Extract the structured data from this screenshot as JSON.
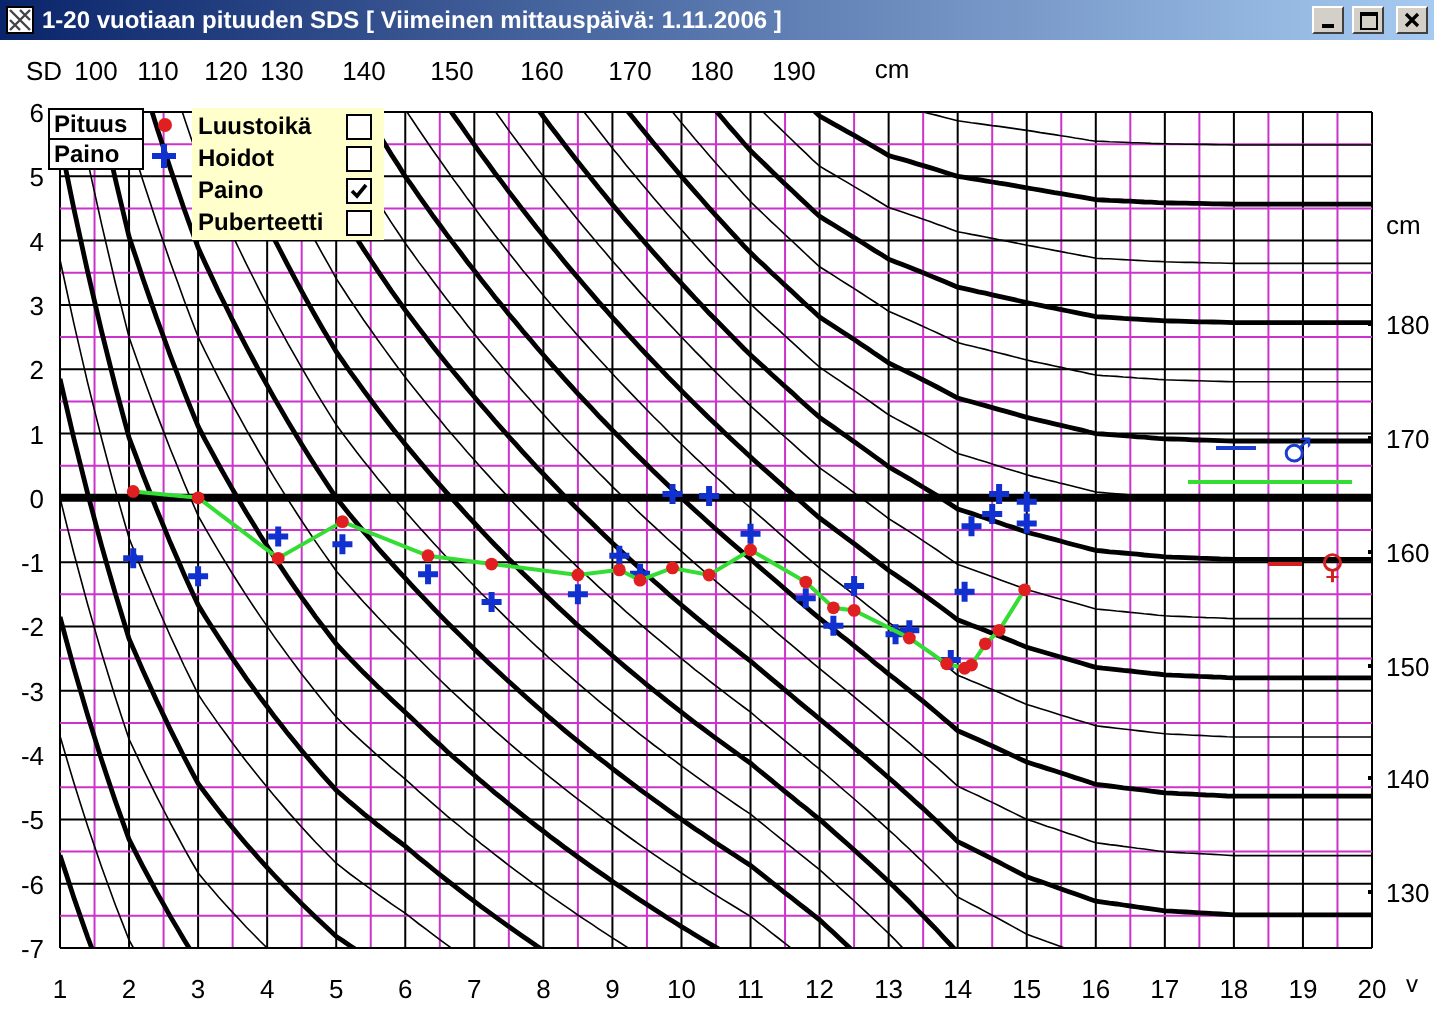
{
  "window": {
    "title": "1-20 vuotiaan pituuden SDS [ Viimeinen mittauspäivä: 1.11.2006 ]"
  },
  "chart": {
    "top_scale": {
      "ticks": [
        "100",
        "110",
        "120",
        "130",
        "140",
        "150",
        "160",
        "170",
        "180",
        "190"
      ],
      "unit": "cm"
    },
    "right_scale": {
      "unit": "cm",
      "ticks": [
        "180",
        "170",
        "160",
        "150",
        "140",
        "130"
      ]
    },
    "options": [
      {
        "label": "Luustoikä",
        "checked": false
      },
      {
        "label": "Hoidot",
        "checked": false
      },
      {
        "label": "Paino",
        "checked": true
      },
      {
        "label": "Puberteetti",
        "checked": false
      }
    ],
    "sex_legend": [
      {
        "symbol": "♂",
        "color": "#1c3cd0"
      },
      {
        "symbol": "♀",
        "color": "#d02020"
      }
    ],
    "chart_data": {
      "type": "scatter",
      "xlabel": "v",
      "ylabel": "SD",
      "xlim": [
        1,
        20
      ],
      "ylim": [
        -7,
        6
      ],
      "grid": true,
      "ref_lines": [
        {
          "axis": "y",
          "value": 0
        }
      ],
      "xticks": [
        1,
        2,
        3,
        4,
        5,
        6,
        7,
        8,
        9,
        10,
        11,
        12,
        13,
        14,
        15,
        16,
        17,
        18,
        19,
        20
      ],
      "yticks": [
        -7,
        -6,
        -5,
        -4,
        -3,
        -2,
        -1,
        0,
        1,
        2,
        3,
        4,
        5,
        6
      ],
      "series": [
        {
          "name": "Pituus",
          "color": "#e02020",
          "type": "line",
          "marker": "circle",
          "x": [
            2.06,
            3.0,
            4.16,
            5.09,
            6.33,
            7.25,
            8.5,
            9.1,
            9.4,
            9.87,
            10.4,
            11.0,
            11.8,
            12.2,
            12.5,
            13.3,
            13.84,
            14.1,
            14.2,
            14.4,
            14.6,
            14.97
          ],
          "values": [
            0.1,
            0.0,
            -0.94,
            -0.37,
            -0.9,
            -1.03,
            -1.2,
            -1.12,
            -1.28,
            -1.09,
            -1.2,
            -0.81,
            -1.31,
            -1.71,
            -1.75,
            -2.18,
            -2.58,
            -2.65,
            -2.6,
            -2.27,
            -2.06,
            -1.43
          ]
        },
        {
          "name": "Paino",
          "color": "#1030d0",
          "type": "scatter",
          "marker": "plus",
          "x": [
            2.06,
            3.0,
            4.16,
            5.09,
            6.33,
            7.25,
            8.5,
            9.1,
            9.4,
            9.87,
            10.4,
            11.0,
            11.8,
            12.2,
            12.5,
            13.1,
            13.3,
            13.9,
            14.1,
            14.2,
            14.5,
            14.6,
            15.0,
            15.0
          ],
          "values": [
            -0.94,
            -1.22,
            -0.6,
            -0.72,
            -1.19,
            -1.62,
            -1.5,
            -0.9,
            -1.18,
            0.06,
            0.03,
            -0.56,
            -1.56,
            -1.99,
            -1.37,
            -2.12,
            -2.06,
            -2.52,
            -1.46,
            -0.44,
            -0.25,
            0.06,
            -0.06,
            -0.4
          ]
        }
      ]
    }
  }
}
